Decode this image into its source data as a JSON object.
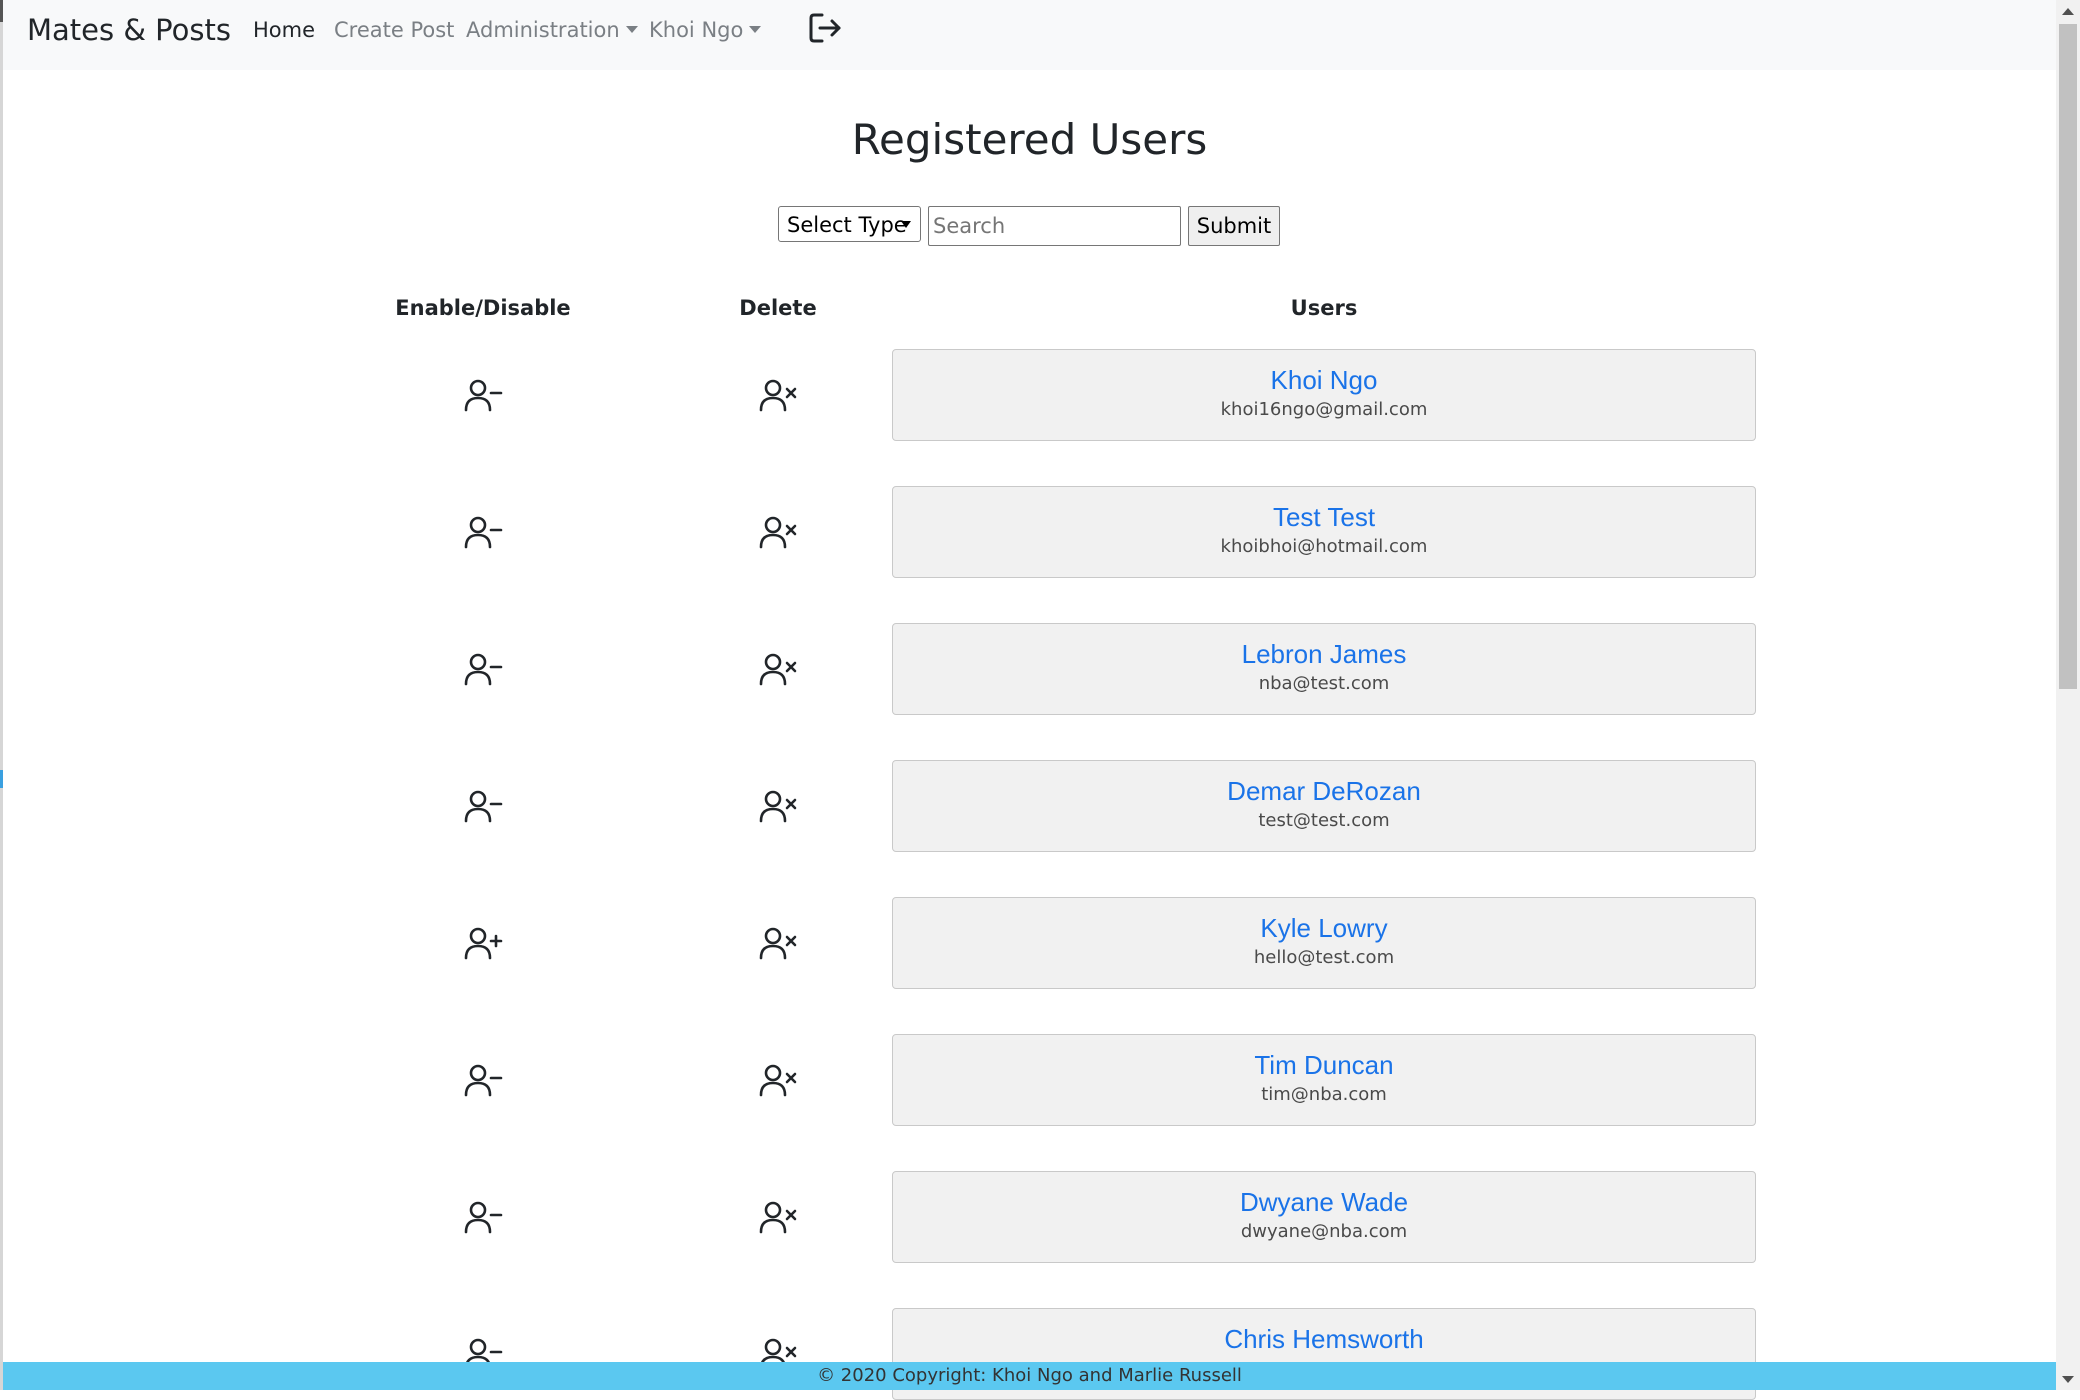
{
  "navbar": {
    "brand": "Mates & Posts",
    "links": {
      "home": "Home",
      "create_post": "Create Post",
      "administration": "Administration",
      "user": "Khoi Ngo"
    },
    "logout_icon": "logout-icon"
  },
  "page": {
    "title": "Registered Users"
  },
  "search": {
    "select_value": "Select Type",
    "placeholder": "Search",
    "value": "",
    "submit_label": "Submit"
  },
  "table": {
    "headers": {
      "enable_disable": "Enable/Disable",
      "delete": "Delete",
      "users": "Users"
    },
    "rows": [
      {
        "name": "Khoi Ngo",
        "email": "khoi16ngo@gmail.com",
        "toggle_icon": "person-dash-icon",
        "delete_icon": "person-x-icon"
      },
      {
        "name": "Test Test",
        "email": "khoibhoi@hotmail.com",
        "toggle_icon": "person-dash-icon",
        "delete_icon": "person-x-icon"
      },
      {
        "name": "Lebron James",
        "email": "nba@test.com",
        "toggle_icon": "person-dash-icon",
        "delete_icon": "person-x-icon"
      },
      {
        "name": "Demar DeRozan",
        "email": "test@test.com",
        "toggle_icon": "person-dash-icon",
        "delete_icon": "person-x-icon"
      },
      {
        "name": "Kyle Lowry",
        "email": "hello@test.com",
        "toggle_icon": "person-plus-icon",
        "delete_icon": "person-x-icon"
      },
      {
        "name": "Tim Duncan",
        "email": "tim@nba.com",
        "toggle_icon": "person-dash-icon",
        "delete_icon": "person-x-icon"
      },
      {
        "name": "Dwyane Wade",
        "email": "dwyane@nba.com",
        "toggle_icon": "person-dash-icon",
        "delete_icon": "person-x-icon"
      },
      {
        "name": "Chris Hemsworth",
        "email": "",
        "toggle_icon": "person-dash-icon",
        "delete_icon": "person-x-icon"
      }
    ]
  },
  "footer": {
    "text": "© 2020 Copyright: Khoi Ngo and Marlie Russell"
  },
  "colors": {
    "navbar_bg": "#f8f9fa",
    "link_blue": "#1a73e8",
    "card_bg": "#f1f1f1",
    "footer_bg": "#5bc8f0"
  }
}
